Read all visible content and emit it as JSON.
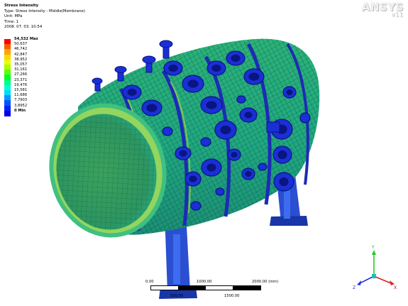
{
  "header": {
    "title": "Stress Intensity",
    "type": "Type: Stress Intensity - Middle(Membrane)",
    "unit": "Unit: MPa",
    "time": "Time: 1",
    "date": "2008. 07. 03. 10:54"
  },
  "legend": [
    {
      "label": "54,532 Max",
      "color": "#ff0000",
      "bold": true
    },
    {
      "label": "50,637",
      "color": "#ff5a00",
      "bold": false
    },
    {
      "label": "46,742",
      "color": "#ffa500",
      "bold": false
    },
    {
      "label": "42,847",
      "color": "#ffd700",
      "bold": false
    },
    {
      "label": "38,952",
      "color": "#e6ff00",
      "bold": false
    },
    {
      "label": "35,057",
      "color": "#a8ff00",
      "bold": false
    },
    {
      "label": "31,161",
      "color": "#5cff00",
      "bold": false
    },
    {
      "label": "27,266",
      "color": "#00ff24",
      "bold": false
    },
    {
      "label": "23,371",
      "color": "#00ff8c",
      "bold": false
    },
    {
      "label": "19,476",
      "color": "#00ffd9",
      "bold": false
    },
    {
      "label": "15,581",
      "color": "#00d9ff",
      "bold": false
    },
    {
      "label": "11,686",
      "color": "#0099ff",
      "bold": false
    },
    {
      "label": "7,7903",
      "color": "#0055ff",
      "bold": false
    },
    {
      "label": "3,8952",
      "color": "#0022ff",
      "bold": false
    },
    {
      "label": "0 Min",
      "color": "#0000e6",
      "bold": true
    }
  ],
  "logo": {
    "brand": "ANSYS",
    "version": "v11"
  },
  "scale": {
    "top_labels": [
      "0.00",
      "1000.00",
      "2000.00 (mm)"
    ],
    "bottom_labels": [
      "500.00",
      "1500.00"
    ]
  },
  "triad": {
    "x": "X",
    "y": "Y",
    "z": "Z"
  },
  "colors": {
    "shell": "#1fa87a",
    "mesh": "#0b3b2a",
    "head": "#2f9a63",
    "nozzle": "#1a2fd6",
    "support": "#2a4fd0"
  }
}
